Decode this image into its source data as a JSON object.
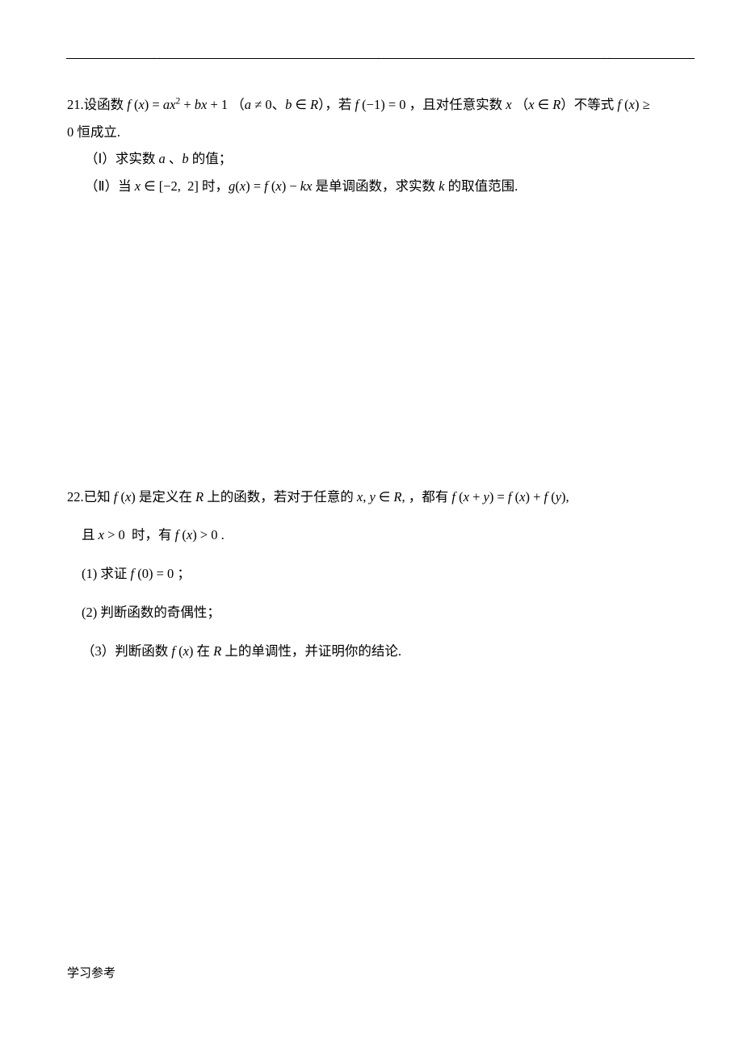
{
  "header": {
    "dot1": ". .",
    "dot2": ".",
    "dot3": ". ."
  },
  "q21": {
    "number": "21.",
    "stem_a": "设函数 ",
    "eq1": "f(x) = ax² + bx + 1",
    "stem_b": "（",
    "cond1": "a ≠ 0",
    "sep1": "、",
    "cond2": "b ∈ R",
    "stem_c": "），若 ",
    "eq2": "f(−1) = 0",
    "stem_d": " ，且对任意实数 ",
    "var_x": "x",
    "stem_e": "（",
    "cond3": "x ∈ R",
    "stem_f": "）不等式 ",
    "eq3": "f(x) ≥",
    "line2a": "0",
    "line2b": " 恒成立.",
    "part1a": "（Ⅰ）求实数 ",
    "part1_a": "a",
    "part1b": " 、",
    "part1_bvar": "b",
    "part1c": " 的值；",
    "part2a": "（Ⅱ）当 ",
    "p2_eq1": "x ∈ [−2, 2]",
    "part2b": " 时，",
    "p2_eq2": "g(x) = f(x) − kx",
    "part2c": " 是单调函数，求实数 ",
    "p2_k": "k",
    "part2d": " 的取值范围."
  },
  "q22": {
    "number": "22.",
    "stem_a": "已知 ",
    "fx": "f(x)",
    "stem_b": " 是定义在 ",
    "R": "R",
    "stem_c": " 上的函数，若对于任意的 ",
    "xy": "x, y ∈ R,",
    "stem_d": " ，都有 ",
    "eq1": "f(x + y) = f(x) + f(y),",
    "line2a": "且 ",
    "cond1": "x > 0",
    "line2b": " 时，有 ",
    "cond2": "f(x) > 0",
    "line2c": " .",
    "p1a": "(1) 求证 ",
    "p1eq": "f(0) = 0",
    "p1b": " ；",
    "p2": "(2) 判断函数的奇偶性；",
    "p3a": "（3）判断函数 ",
    "p3fx": "f(x)",
    "p3b": " 在 ",
    "p3R": "R",
    "p3c": " 上的单调性，并证明你的结论."
  },
  "footer": "学习参考"
}
